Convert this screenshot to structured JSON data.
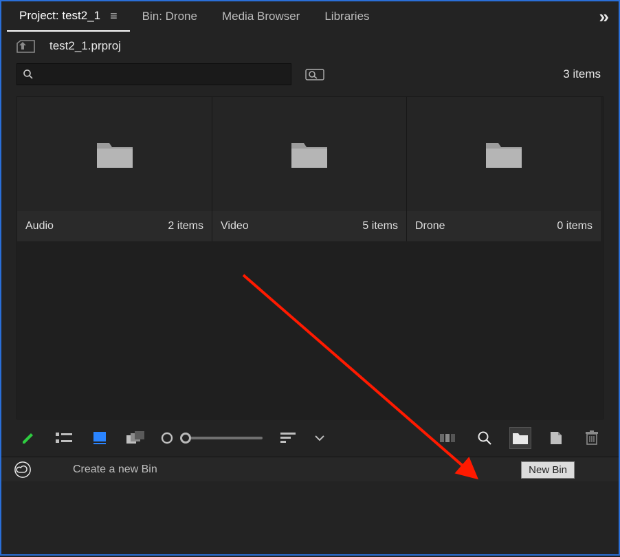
{
  "tabs": {
    "project": {
      "label": "Project: test2_1"
    },
    "bin": {
      "label": "Bin: Drone"
    },
    "mediaBrowser": {
      "label": "Media Browser"
    },
    "libraries": {
      "label": "Libraries"
    }
  },
  "breadcrumb": {
    "filename": "test2_1.prproj"
  },
  "search": {
    "value": ""
  },
  "itemCount": "3 items",
  "bins": [
    {
      "name": "Audio",
      "count": "2 items"
    },
    {
      "name": "Video",
      "count": "5 items"
    },
    {
      "name": "Drone",
      "count": "0 items"
    }
  ],
  "tooltip": "New Bin",
  "status": "Create a new Bin"
}
